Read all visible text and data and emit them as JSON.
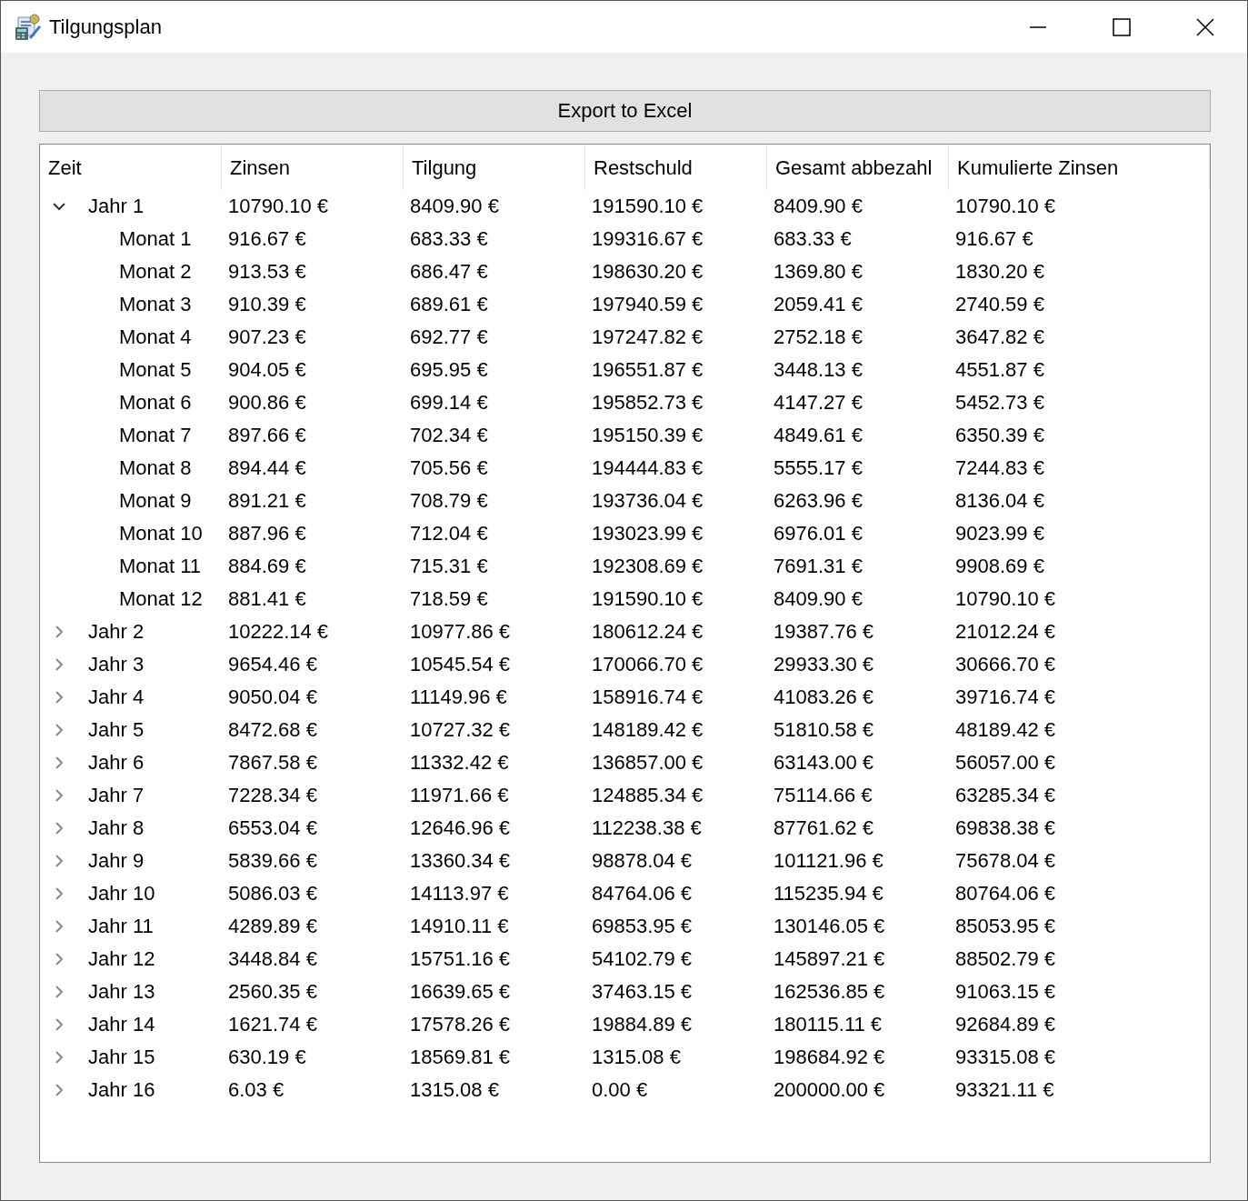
{
  "window": {
    "title": "Tilgungsplan"
  },
  "export_button": {
    "label": "Export to Excel"
  },
  "tree": {
    "columns": [
      "Zeit",
      "Zinsen",
      "Tilgung",
      "Restschuld",
      "Gesamt abbezahl",
      "Kumulierte Zinsen"
    ],
    "rows": [
      {
        "label": "Jahr 1",
        "values": [
          "10790.10 €",
          "8409.90 €",
          "191590.10 €",
          "8409.90 €",
          "10790.10 €"
        ],
        "expanded": true,
        "children": [
          {
            "label": "Monat 1",
            "values": [
              "916.67 €",
              "683.33 €",
              "199316.67 €",
              "683.33 €",
              "916.67 €"
            ]
          },
          {
            "label": "Monat 2",
            "values": [
              "913.53 €",
              "686.47 €",
              "198630.20 €",
              "1369.80 €",
              "1830.20 €"
            ]
          },
          {
            "label": "Monat 3",
            "values": [
              "910.39 €",
              "689.61 €",
              "197940.59 €",
              "2059.41 €",
              "2740.59 €"
            ]
          },
          {
            "label": "Monat 4",
            "values": [
              "907.23 €",
              "692.77 €",
              "197247.82 €",
              "2752.18 €",
              "3647.82 €"
            ]
          },
          {
            "label": "Monat 5",
            "values": [
              "904.05 €",
              "695.95 €",
              "196551.87 €",
              "3448.13 €",
              "4551.87 €"
            ]
          },
          {
            "label": "Monat 6",
            "values": [
              "900.86 €",
              "699.14 €",
              "195852.73 €",
              "4147.27 €",
              "5452.73 €"
            ]
          },
          {
            "label": "Monat 7",
            "values": [
              "897.66 €",
              "702.34 €",
              "195150.39 €",
              "4849.61 €",
              "6350.39 €"
            ]
          },
          {
            "label": "Monat 8",
            "values": [
              "894.44 €",
              "705.56 €",
              "194444.83 €",
              "5555.17 €",
              "7244.83 €"
            ]
          },
          {
            "label": "Monat 9",
            "values": [
              "891.21 €",
              "708.79 €",
              "193736.04 €",
              "6263.96 €",
              "8136.04 €"
            ]
          },
          {
            "label": "Monat 10",
            "values": [
              "887.96 €",
              "712.04 €",
              "193023.99 €",
              "6976.01 €",
              "9023.99 €"
            ]
          },
          {
            "label": "Monat 11",
            "values": [
              "884.69 €",
              "715.31 €",
              "192308.69 €",
              "7691.31 €",
              "9908.69 €"
            ]
          },
          {
            "label": "Monat 12",
            "values": [
              "881.41 €",
              "718.59 €",
              "191590.10 €",
              "8409.90 €",
              "10790.10 €"
            ]
          }
        ]
      },
      {
        "label": "Jahr 2",
        "values": [
          "10222.14 €",
          "10977.86 €",
          "180612.24 €",
          "19387.76 €",
          "21012.24 €"
        ],
        "expanded": false
      },
      {
        "label": "Jahr 3",
        "values": [
          "9654.46 €",
          "10545.54 €",
          "170066.70 €",
          "29933.30 €",
          "30666.70 €"
        ],
        "expanded": false
      },
      {
        "label": "Jahr 4",
        "values": [
          "9050.04 €",
          "11149.96 €",
          "158916.74 €",
          "41083.26 €",
          "39716.74 €"
        ],
        "expanded": false
      },
      {
        "label": "Jahr 5",
        "values": [
          "8472.68 €",
          "10727.32 €",
          "148189.42 €",
          "51810.58 €",
          "48189.42 €"
        ],
        "expanded": false
      },
      {
        "label": "Jahr 6",
        "values": [
          "7867.58 €",
          "11332.42 €",
          "136857.00 €",
          "63143.00 €",
          "56057.00 €"
        ],
        "expanded": false
      },
      {
        "label": "Jahr 7",
        "values": [
          "7228.34 €",
          "11971.66 €",
          "124885.34 €",
          "75114.66 €",
          "63285.34 €"
        ],
        "expanded": false
      },
      {
        "label": "Jahr 8",
        "values": [
          "6553.04 €",
          "12646.96 €",
          "112238.38 €",
          "87761.62 €",
          "69838.38 €"
        ],
        "expanded": false
      },
      {
        "label": "Jahr 9",
        "values": [
          "5839.66 €",
          "13360.34 €",
          "98878.04 €",
          "101121.96 €",
          "75678.04 €"
        ],
        "expanded": false
      },
      {
        "label": "Jahr 10",
        "values": [
          "5086.03 €",
          "14113.97 €",
          "84764.06 €",
          "115235.94 €",
          "80764.06 €"
        ],
        "expanded": false
      },
      {
        "label": "Jahr 11",
        "values": [
          "4289.89 €",
          "14910.11 €",
          "69853.95 €",
          "130146.05 €",
          "85053.95 €"
        ],
        "expanded": false
      },
      {
        "label": "Jahr 12",
        "values": [
          "3448.84 €",
          "15751.16 €",
          "54102.79 €",
          "145897.21 €",
          "88502.79 €"
        ],
        "expanded": false
      },
      {
        "label": "Jahr 13",
        "values": [
          "2560.35 €",
          "16639.65 €",
          "37463.15 €",
          "162536.85 €",
          "91063.15 €"
        ],
        "expanded": false
      },
      {
        "label": "Jahr 14",
        "values": [
          "1621.74 €",
          "17578.26 €",
          "19884.89 €",
          "180115.11 €",
          "92684.89 €"
        ],
        "expanded": false
      },
      {
        "label": "Jahr 15",
        "values": [
          "630.19 €",
          "18569.81 €",
          "1315.08 €",
          "198684.92 €",
          "93315.08 €"
        ],
        "expanded": false
      },
      {
        "label": "Jahr 16",
        "values": [
          "6.03 €",
          "1315.08 €",
          "0.00 €",
          "200000.00 €",
          "93321.11 €"
        ],
        "expanded": false
      }
    ]
  }
}
